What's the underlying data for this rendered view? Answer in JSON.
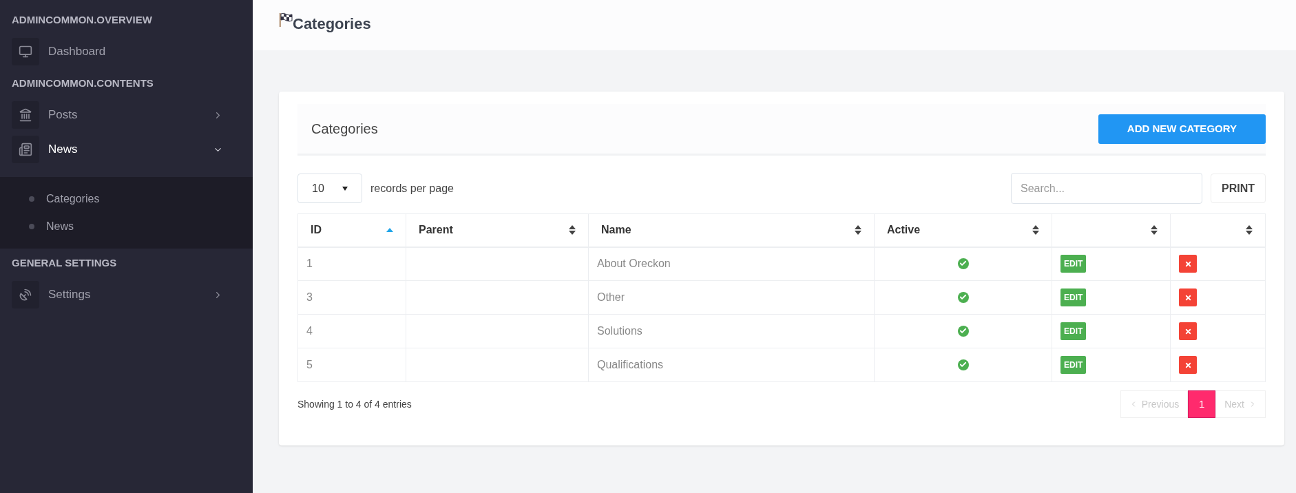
{
  "sidebar": {
    "sections": [
      {
        "title": "ADMINCOMMON.OVERVIEW",
        "items": [
          {
            "label": "Dashboard"
          }
        ]
      },
      {
        "title": "ADMINCOMMON.CONTENTS",
        "items": [
          {
            "label": "Posts",
            "expanded": false
          },
          {
            "label": "News",
            "expanded": true,
            "children": [
              {
                "label": "Categories"
              },
              {
                "label": "News"
              }
            ]
          }
        ]
      },
      {
        "title": "GENERAL SETTINGS",
        "items": [
          {
            "label": "Settings",
            "expanded": false
          }
        ]
      }
    ]
  },
  "page_title": "Categories",
  "card": {
    "title": "Categories",
    "add_button": "ADD NEW CATEGORY",
    "page_size": "10",
    "page_size_label": "records per page",
    "search": {
      "placeholder": "Search..."
    },
    "print_button": "PRINT",
    "table": {
      "columns": [
        {
          "label": "ID",
          "sorted": true
        },
        {
          "label": "Parent",
          "sorted": false
        },
        {
          "label": "Name",
          "sorted": false
        },
        {
          "label": "Active",
          "sorted": false
        },
        {
          "sorted": false
        },
        {
          "sorted": false
        }
      ],
      "rows": [
        {
          "id": "1",
          "name": "About Oreckon",
          "active": true,
          "edit": "EDIT"
        },
        {
          "id": "3",
          "name": "Other",
          "active": true,
          "edit": "EDIT"
        },
        {
          "id": "4",
          "name": "Solutions",
          "active": true,
          "edit": "EDIT"
        },
        {
          "id": "5",
          "name": "Qualifications",
          "active": true,
          "edit": "EDIT"
        }
      ]
    },
    "info": "Showing 1 to 4 of 4 entries",
    "pagination": {
      "previous": {
        "label": "Previous",
        "disabled": true
      },
      "pages": [
        {
          "label": "1",
          "selected": true
        }
      ],
      "next": {
        "label": "Next",
        "disabled": true
      }
    }
  }
}
